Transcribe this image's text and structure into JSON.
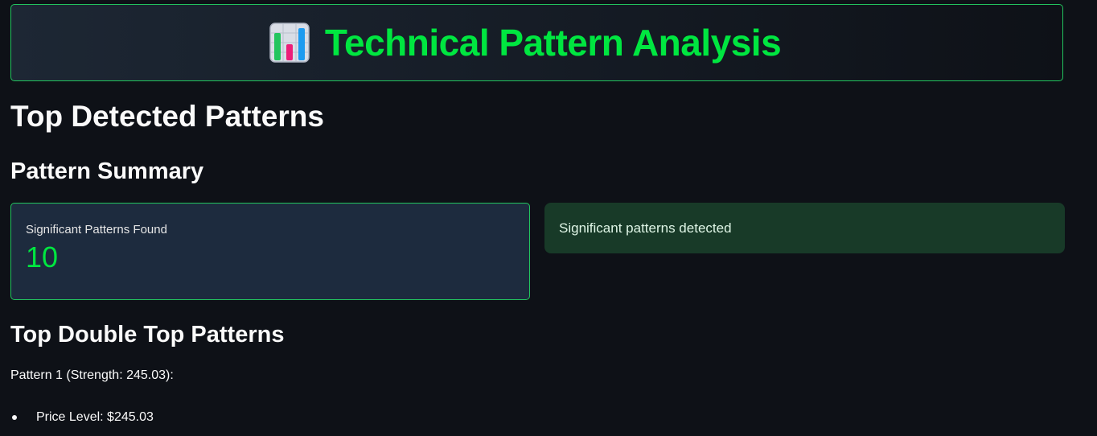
{
  "header": {
    "icon": "bar-chart-icon",
    "title": "Technical Pattern Analysis",
    "accent_color": "#00e640"
  },
  "main": {
    "heading": "Top Detected Patterns",
    "summary_heading": "Pattern Summary",
    "metric": {
      "label": "Significant Patterns Found",
      "value": "10"
    },
    "status_message": "Significant patterns detected",
    "double_top_heading": "Top Double Top Patterns",
    "patterns": [
      {
        "title": "Pattern 1 (Strength: 245.03):",
        "details": [
          "Price Level: $245.03"
        ]
      }
    ]
  }
}
